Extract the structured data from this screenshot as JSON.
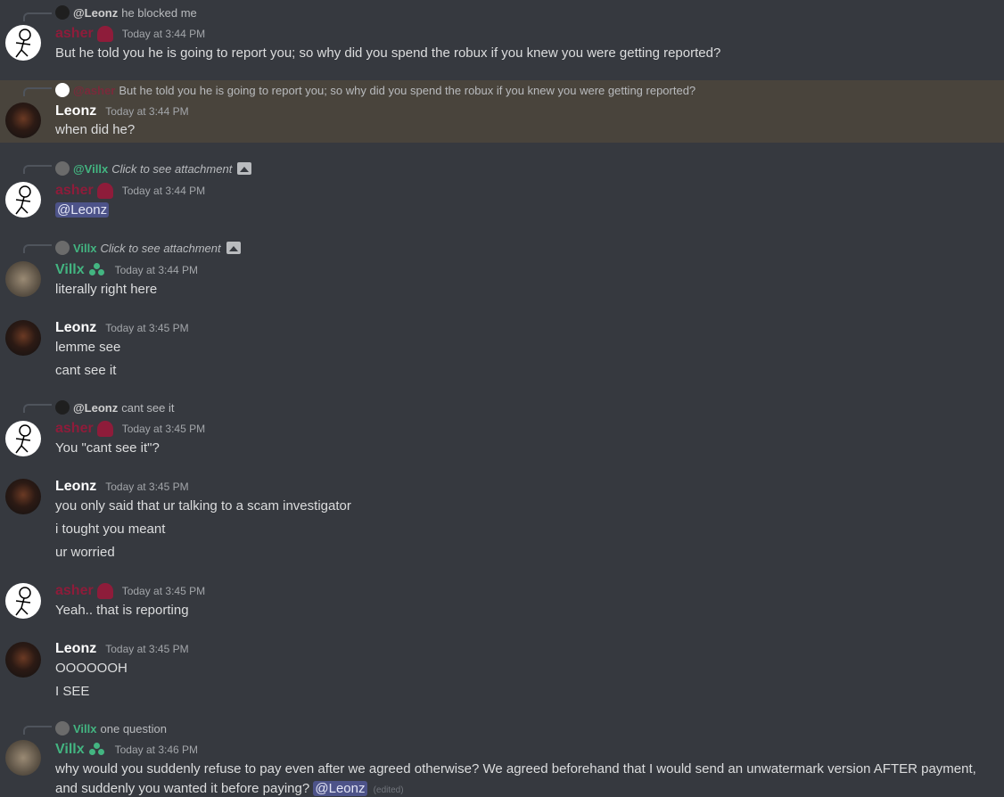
{
  "messages": [
    {
      "reply": {
        "avatar": "leonz-avatar",
        "name": "@Leonz",
        "text": "he blocked me"
      },
      "author": "asher",
      "timestamp": "Today at 3:44 PM",
      "lines": [
        "But he told you he is going to report you; so why did you spend the robux if you knew you were getting reported?"
      ]
    },
    {
      "reply": {
        "avatar": "asher-avatar",
        "name": "@asher",
        "text": "But he told you he is going to report you; so why did you spend the robux if you knew you were getting reported?"
      },
      "author": "Leonz",
      "timestamp": "Today at 3:44 PM",
      "lines": [
        "when did he?"
      ],
      "highlighted": true
    },
    {
      "reply": {
        "avatar": "villx-avatar",
        "name": "@Villx",
        "text": "Click to see attachment",
        "icon": "image-icon"
      },
      "author": "asher",
      "timestamp": "Today at 3:44 PM",
      "mention": "@Leonz"
    },
    {
      "reply": {
        "avatar": "villx-avatar",
        "name": "Villx",
        "text": "Click to see attachment",
        "icon": "image-icon"
      },
      "author": "Villx",
      "timestamp": "Today at 3:44 PM",
      "lines": [
        "literally right here"
      ]
    },
    {
      "author": "Leonz",
      "timestamp": "Today at 3:45 PM",
      "lines": [
        "lemme see",
        "cant see it"
      ]
    },
    {
      "reply": {
        "avatar": "leonz-avatar",
        "name": "@Leonz",
        "text": "cant see it"
      },
      "author": "asher",
      "timestamp": "Today at 3:45 PM",
      "lines": [
        "You \"cant see it\"?"
      ]
    },
    {
      "author": "Leonz",
      "timestamp": "Today at 3:45 PM",
      "lines": [
        "you only said that ur talking to a scam investigator",
        "i tought you meant",
        "ur worried"
      ]
    },
    {
      "author": "asher",
      "timestamp": "Today at 3:45 PM",
      "lines": [
        "Yeah.. that is reporting"
      ]
    },
    {
      "author": "Leonz",
      "timestamp": "Today at 3:45 PM",
      "lines": [
        "OOOOOOH",
        "I SEE"
      ]
    },
    {
      "reply": {
        "avatar": "villx-avatar",
        "name": "Villx",
        "text": "one question"
      },
      "author": "Villx",
      "timestamp": "Today at 3:46 PM",
      "long_text": "why would you suddenly refuse to pay even after we agreed otherwise? We agreed beforehand that I would send an unwatermark version AFTER payment, and suddenly you wanted it before paying?",
      "mention": "@Leonz",
      "edited": "(edited)"
    }
  ],
  "colors": {
    "background": "#36393f",
    "highlight": "#49443c",
    "asher": "#8e1c3a",
    "villx": "#43b581",
    "mention_bg": "#4d5389"
  }
}
